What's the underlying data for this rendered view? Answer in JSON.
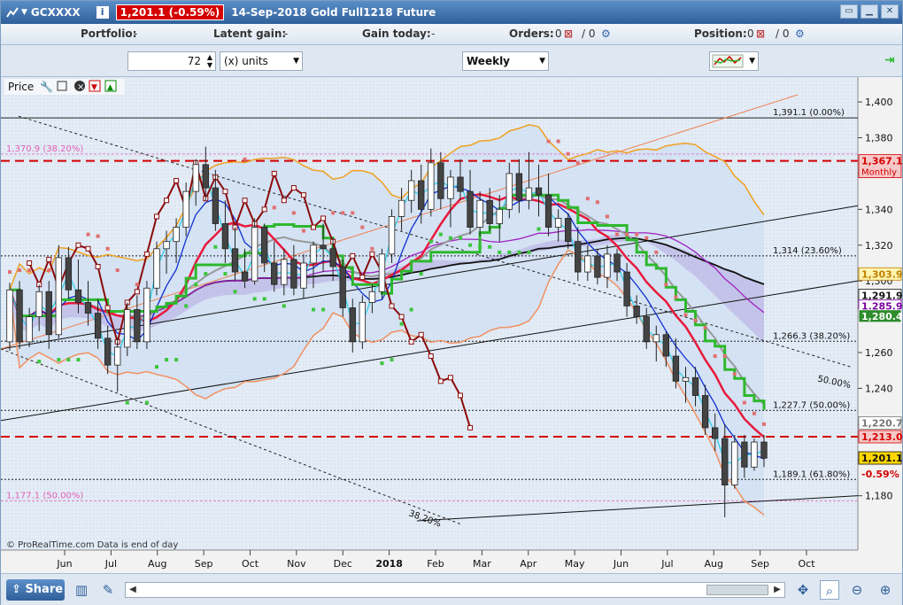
{
  "titlebar": {
    "symbol": "GCXXXX",
    "info_icon": "i",
    "last_price": "1,201.1 (-0.59%)",
    "title": "14-Sep-2018 Gold Full1218 Future"
  },
  "portfolio_bar": {
    "portfolio_label": "Portfolio:",
    "portfolio_value": "-",
    "latent_label": "Latent gain:",
    "latent_value": "-",
    "gain_today_label": "Gain today:",
    "gain_today_value": "-",
    "orders_label": "Orders:",
    "orders_value": "0",
    "orders_value2": "/ 0",
    "position_label": "Position:",
    "position_value": "0",
    "position_value2": "/ 0"
  },
  "toolbar": {
    "units_value": "72",
    "units_label": "(x) units",
    "period": "Weekly"
  },
  "chart_data": {
    "type": "candlestick",
    "title": "Price",
    "watermark": "© ProRealTime.com  Data is end of day",
    "x_labels": [
      "Jun",
      "Jul",
      "Aug",
      "Sep",
      "Oct",
      "Nov",
      "Dec",
      "2018",
      "Feb",
      "Mar",
      "Apr",
      "May",
      "Jun",
      "Jul",
      "Aug",
      "Sep",
      "Oct"
    ],
    "y_ticks": [
      1180,
      1200,
      1220,
      1240,
      1260,
      1280,
      1300,
      1320,
      1340,
      1360,
      1380,
      1400
    ],
    "y_range": [
      1164,
      1404
    ],
    "candles": [
      {
        "o": 1266,
        "h": 1299,
        "l": 1261,
        "c": 1295
      },
      {
        "o": 1295,
        "h": 1300,
        "l": 1262,
        "c": 1266
      },
      {
        "o": 1266,
        "h": 1285,
        "l": 1263,
        "c": 1280
      },
      {
        "o": 1280,
        "h": 1298,
        "l": 1272,
        "c": 1294
      },
      {
        "o": 1294,
        "h": 1300,
        "l": 1262,
        "c": 1270
      },
      {
        "o": 1270,
        "h": 1320,
        "l": 1268,
        "c": 1313
      },
      {
        "o": 1313,
        "h": 1319,
        "l": 1290,
        "c": 1295
      },
      {
        "o": 1295,
        "h": 1312,
        "l": 1282,
        "c": 1288
      },
      {
        "o": 1288,
        "h": 1300,
        "l": 1275,
        "c": 1282
      },
      {
        "o": 1282,
        "h": 1290,
        "l": 1262,
        "c": 1268
      },
      {
        "o": 1268,
        "h": 1275,
        "l": 1248,
        "c": 1253
      },
      {
        "o": 1253,
        "h": 1268,
        "l": 1238,
        "c": 1263
      },
      {
        "o": 1263,
        "h": 1288,
        "l": 1258,
        "c": 1284
      },
      {
        "o": 1284,
        "h": 1292,
        "l": 1262,
        "c": 1266
      },
      {
        "o": 1266,
        "h": 1300,
        "l": 1262,
        "c": 1296
      },
      {
        "o": 1296,
        "h": 1322,
        "l": 1292,
        "c": 1318
      },
      {
        "o": 1318,
        "h": 1328,
        "l": 1304,
        "c": 1322
      },
      {
        "o": 1322,
        "h": 1335,
        "l": 1310,
        "c": 1330
      },
      {
        "o": 1330,
        "h": 1355,
        "l": 1325,
        "c": 1350
      },
      {
        "o": 1350,
        "h": 1368,
        "l": 1342,
        "c": 1365
      },
      {
        "o": 1365,
        "h": 1375,
        "l": 1345,
        "c": 1352
      },
      {
        "o": 1352,
        "h": 1362,
        "l": 1328,
        "c": 1332
      },
      {
        "o": 1332,
        "h": 1345,
        "l": 1310,
        "c": 1318
      },
      {
        "o": 1318,
        "h": 1330,
        "l": 1300,
        "c": 1305
      },
      {
        "o": 1305,
        "h": 1318,
        "l": 1296,
        "c": 1300
      },
      {
        "o": 1300,
        "h": 1335,
        "l": 1298,
        "c": 1330
      },
      {
        "o": 1330,
        "h": 1332,
        "l": 1305,
        "c": 1310
      },
      {
        "o": 1310,
        "h": 1322,
        "l": 1294,
        "c": 1298
      },
      {
        "o": 1298,
        "h": 1318,
        "l": 1292,
        "c": 1312
      },
      {
        "o": 1312,
        "h": 1320,
        "l": 1292,
        "c": 1296
      },
      {
        "o": 1296,
        "h": 1315,
        "l": 1290,
        "c": 1310
      },
      {
        "o": 1310,
        "h": 1322,
        "l": 1296,
        "c": 1320
      },
      {
        "o": 1320,
        "h": 1332,
        "l": 1305,
        "c": 1318
      },
      {
        "o": 1318,
        "h": 1324,
        "l": 1300,
        "c": 1308
      },
      {
        "o": 1308,
        "h": 1312,
        "l": 1280,
        "c": 1285
      },
      {
        "o": 1285,
        "h": 1290,
        "l": 1260,
        "c": 1266
      },
      {
        "o": 1266,
        "h": 1292,
        "l": 1262,
        "c": 1288
      },
      {
        "o": 1288,
        "h": 1298,
        "l": 1282,
        "c": 1294
      },
      {
        "o": 1294,
        "h": 1318,
        "l": 1290,
        "c": 1315
      },
      {
        "o": 1315,
        "h": 1340,
        "l": 1310,
        "c": 1336
      },
      {
        "o": 1336,
        "h": 1352,
        "l": 1328,
        "c": 1345
      },
      {
        "o": 1345,
        "h": 1362,
        "l": 1338,
        "c": 1356
      },
      {
        "o": 1356,
        "h": 1365,
        "l": 1332,
        "c": 1340
      },
      {
        "o": 1340,
        "h": 1374,
        "l": 1336,
        "c": 1366
      },
      {
        "o": 1366,
        "h": 1372,
        "l": 1340,
        "c": 1346
      },
      {
        "o": 1346,
        "h": 1362,
        "l": 1330,
        "c": 1358
      },
      {
        "o": 1358,
        "h": 1368,
        "l": 1345,
        "c": 1350
      },
      {
        "o": 1350,
        "h": 1362,
        "l": 1326,
        "c": 1330
      },
      {
        "o": 1330,
        "h": 1350,
        "l": 1325,
        "c": 1345
      },
      {
        "o": 1345,
        "h": 1352,
        "l": 1328,
        "c": 1332
      },
      {
        "o": 1332,
        "h": 1348,
        "l": 1322,
        "c": 1340
      },
      {
        "o": 1340,
        "h": 1366,
        "l": 1335,
        "c": 1360
      },
      {
        "o": 1360,
        "h": 1368,
        "l": 1338,
        "c": 1345
      },
      {
        "o": 1345,
        "h": 1372,
        "l": 1340,
        "c": 1352
      },
      {
        "o": 1352,
        "h": 1365,
        "l": 1336,
        "c": 1348
      },
      {
        "o": 1348,
        "h": 1360,
        "l": 1325,
        "c": 1330
      },
      {
        "o": 1330,
        "h": 1340,
        "l": 1322,
        "c": 1335
      },
      {
        "o": 1335,
        "h": 1338,
        "l": 1318,
        "c": 1322
      },
      {
        "o": 1322,
        "h": 1330,
        "l": 1300,
        "c": 1305
      },
      {
        "o": 1305,
        "h": 1320,
        "l": 1300,
        "c": 1314
      },
      {
        "o": 1314,
        "h": 1318,
        "l": 1298,
        "c": 1302
      },
      {
        "o": 1302,
        "h": 1320,
        "l": 1296,
        "c": 1315
      },
      {
        "o": 1315,
        "h": 1318,
        "l": 1300,
        "c": 1305
      },
      {
        "o": 1305,
        "h": 1310,
        "l": 1280,
        "c": 1286
      },
      {
        "o": 1286,
        "h": 1292,
        "l": 1276,
        "c": 1280
      },
      {
        "o": 1280,
        "h": 1285,
        "l": 1262,
        "c": 1266
      },
      {
        "o": 1266,
        "h": 1275,
        "l": 1255,
        "c": 1270
      },
      {
        "o": 1270,
        "h": 1272,
        "l": 1252,
        "c": 1258
      },
      {
        "o": 1258,
        "h": 1268,
        "l": 1240,
        "c": 1244
      },
      {
        "o": 1244,
        "h": 1252,
        "l": 1232,
        "c": 1246
      },
      {
        "o": 1246,
        "h": 1252,
        "l": 1230,
        "c": 1236
      },
      {
        "o": 1236,
        "h": 1242,
        "l": 1214,
        "c": 1218
      },
      {
        "o": 1218,
        "h": 1226,
        "l": 1205,
        "c": 1212
      },
      {
        "o": 1212,
        "h": 1220,
        "l": 1168,
        "c": 1186
      },
      {
        "o": 1186,
        "h": 1214,
        "l": 1184,
        "c": 1210
      },
      {
        "o": 1210,
        "h": 1214,
        "l": 1190,
        "c": 1196
      },
      {
        "o": 1196,
        "h": 1212,
        "l": 1194,
        "c": 1210
      },
      {
        "o": 1210,
        "h": 1214,
        "l": 1196,
        "c": 1201
      }
    ],
    "horizontal_levels": [
      {
        "value": 1391.1,
        "label": "1,391.1 (0.00%)",
        "style": "solid"
      },
      {
        "value": 1314,
        "label": "1,314 (23.60%)",
        "style": "dotted"
      },
      {
        "value": 1266.3,
        "label": "1,266.3 (38.20%)",
        "style": "dotted"
      },
      {
        "value": 1227.7,
        "label": "1,227.7 (50.00%)",
        "style": "dotted"
      },
      {
        "value": 1189.1,
        "label": "1,189.1 (61.80%)",
        "style": "dotted"
      }
    ],
    "pink_levels": [
      {
        "value": 1370.9,
        "label": "1,370.9 (38.20%)"
      },
      {
        "value": 1177.1,
        "label": "1,177.1 (50.00%)"
      }
    ],
    "red_dashed_levels": [
      1367.1,
      1213.0
    ],
    "trendline_labels": [
      {
        "label": "50.00%"
      },
      {
        "label": "38.20%"
      }
    ],
    "price_tags": [
      {
        "value": 1367.1,
        "text": "1,367.1",
        "sub": "Monthly",
        "color": "#d40000",
        "bg": "#f6c8c8"
      },
      {
        "value": 1303.9,
        "text": "1,303.9",
        "color": "#c08000",
        "bg": "#fff4b0"
      },
      {
        "value": 1291.9,
        "text": "1,291.9",
        "color": "#111111",
        "bg": "#ffffff"
      },
      {
        "value": 1285.9,
        "text": "1,285.9",
        "color": "#7a00a0",
        "bg": "#ffffff"
      },
      {
        "value": 1280.4,
        "text": "1,280.4",
        "color": "#ffffff",
        "bg": "#2e8b2e"
      },
      {
        "value": 1220.7,
        "text": "1,220.7",
        "color": "#777777",
        "bg": "#ffffff"
      },
      {
        "value": 1213.0,
        "text": "1,213.0",
        "color": "#d40000",
        "bg": "#f6c8c8"
      },
      {
        "value": 1201.1,
        "text": "1,201.1",
        "color": "#111111",
        "bg": "#ffd700"
      }
    ],
    "last_change": "-0.59%",
    "colors": {
      "accent": "#2f5f9a",
      "up": "#ffffff",
      "down": "#444444",
      "red": "#d40000",
      "green": "#2eb82e"
    }
  }
}
